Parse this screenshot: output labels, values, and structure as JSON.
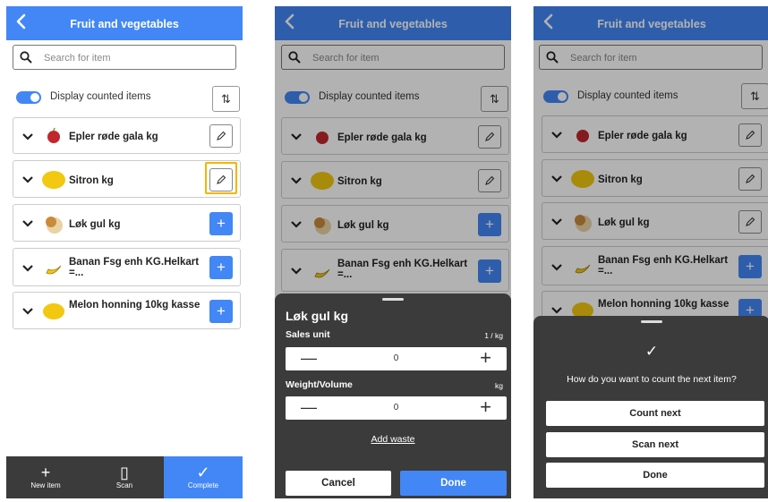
{
  "colors": {
    "accent": "#4287f5",
    "highlight": "#f5b400",
    "dark": "#3b3b3b"
  },
  "header": {
    "title": "Fruit and vegetables",
    "back_icon": "chevron-left-icon"
  },
  "search": {
    "placeholder": "Search for item",
    "icon": "search-icon"
  },
  "toggle": {
    "label": "Display counted items",
    "on": true
  },
  "sort": {
    "icon": "sort-arrows-icon",
    "glyph": "⇅"
  },
  "items": [
    {
      "name": "Epler røde gala kg",
      "icon": "apple-icon",
      "action": "edit"
    },
    {
      "name": "Sitron kg",
      "icon": "lemon-icon",
      "action": "edit"
    },
    {
      "name": "Løk gul kg",
      "icon": "onion-icon",
      "action": "add"
    },
    {
      "name": "Banan Fsg enh KG.Helkart =...",
      "icon": "banana-icon",
      "action": "add"
    },
    {
      "name": "Melon honning 10kg kasse",
      "icon": "melon-icon",
      "action": "add"
    }
  ],
  "screen3_items": [
    {
      "name": "Epler røde gala kg",
      "action": "edit"
    },
    {
      "name": "Sitron kg",
      "action": "edit"
    },
    {
      "name": "Løk gul kg",
      "action": "edit"
    },
    {
      "name": "Banan Fsg enh KG.Helkart =...",
      "action": "add"
    },
    {
      "name": "Melon honning 10kg kasse",
      "action": "add"
    }
  ],
  "bottom_bar": {
    "new_item": {
      "label": "New item",
      "glyph": "+"
    },
    "scan": {
      "label": "Scan",
      "glyph": "▯"
    },
    "complete": {
      "label": "Complete",
      "glyph": "✓"
    }
  },
  "count_sheet": {
    "title": "Løk gul kg",
    "sales_unit_label": "Sales unit",
    "sales_unit_suffix": "1 / kg",
    "sales_unit_value": "0",
    "weight_label": "Weight/Volume",
    "weight_suffix": "kg",
    "weight_value": "0",
    "minus_glyph": "—",
    "plus_glyph": "+",
    "add_waste": "Add waste",
    "cancel": "Cancel",
    "done": "Done"
  },
  "next_sheet": {
    "check_glyph": "✓",
    "question": "How do you want to count the next item?",
    "count_next": "Count next",
    "scan_next": "Scan next",
    "done": "Done"
  }
}
